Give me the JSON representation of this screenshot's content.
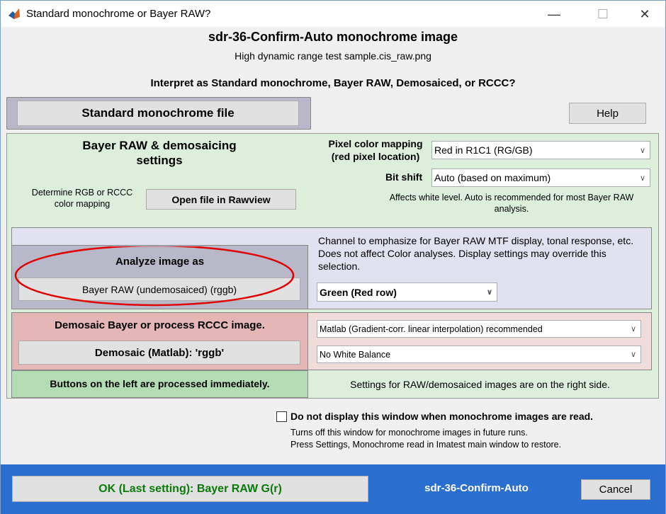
{
  "window": {
    "title": "Standard monochrome or Bayer RAW?",
    "minimize": "—",
    "maximize": "☐",
    "close": "✕"
  },
  "header": {
    "title": "sdr-36-Confirm-Auto monochrome image",
    "filename": "High dynamic range test sample.cis_raw.png",
    "question": "Interpret as Standard monochrome, Bayer RAW, Demosaiced, or RCCC?"
  },
  "top": {
    "standard_button": "Standard monochrome file",
    "help_button": "Help"
  },
  "bayer_settings": {
    "heading": "Bayer RAW & demosaicing settings",
    "determine_label": "Determine RGB or RCCC color mapping",
    "open_rawview_button": "Open file in Rawview",
    "pixel_mapping_label": "Pixel color mapping (red pixel location)",
    "pixel_mapping_value": "Red in R1C1  (RG/GB)",
    "bit_shift_label": "Bit shift",
    "bit_shift_value": "Auto    (based on maximum)",
    "bit_shift_note": "Affects white level. Auto is recommended for most Bayer RAW analysis."
  },
  "analyze": {
    "heading": "Analyze image as",
    "button": "Bayer RAW (undemosaiced)  (rggb)",
    "channel_note": "Channel to emphasize for Bayer RAW MTF display, tonal response, etc. Does not affect Color analyses. Display settings may override this selection.",
    "channel_value": "Green (Red row)"
  },
  "demosaic": {
    "heading": "Demosaic Bayer or process RCCC image.",
    "button": "Demosaic (Matlab):  'rggb'",
    "algorithm_value": "Matlab   (Gradient-corr. linear interpolation)  recommended",
    "white_balance_value": "No White Balance"
  },
  "footer_notes": {
    "left": "Buttons on the left are processed immediately.",
    "right": "Settings for RAW/demosaiced images are on the right side."
  },
  "checkbox": {
    "label": "Do not display this window when monochrome images are read.",
    "checked": false,
    "note_line1": "Turns off this window for monochrome images in future runs.",
    "note_line2": "Press Settings, Monochrome read in Imatest main window to restore."
  },
  "bottom": {
    "ok_button": "OK (Last setting):  Bayer RAW G(r)",
    "name": "sdr-36-Confirm-Auto",
    "cancel_button": "Cancel"
  },
  "colors": {
    "green_panel": "#ddeedd",
    "lavender_panel": "#e1e1ef",
    "pink_panel": "#f1dcdc",
    "dark_green": "#b3dcb3",
    "bottom_blue": "#2a6fcf",
    "ok_text": "#0a7a0a",
    "annotation_red": "#e00000"
  }
}
